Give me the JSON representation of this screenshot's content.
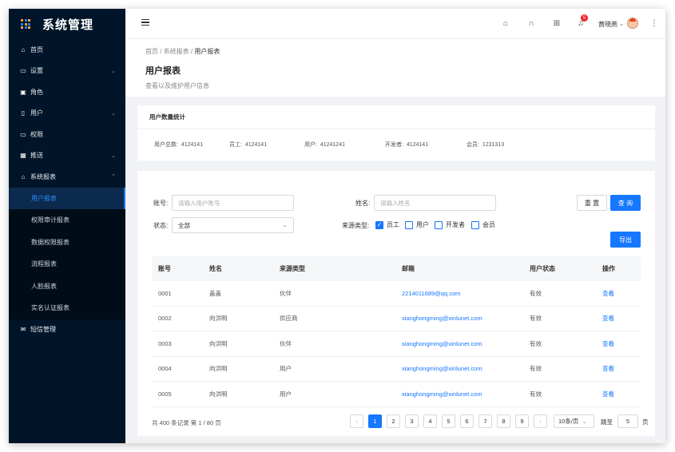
{
  "app": {
    "title": "系统管理"
  },
  "sidebar": {
    "items": [
      {
        "label": "首页",
        "icon": "home-icon"
      },
      {
        "label": "设置",
        "icon": "settings-icon"
      },
      {
        "label": "角色",
        "icon": "role-icon"
      },
      {
        "label": "用户",
        "icon": "user-icon"
      },
      {
        "label": "权限",
        "icon": "permission-icon"
      },
      {
        "label": "推送",
        "icon": "push-icon"
      },
      {
        "label": "系统报表",
        "icon": "home-icon"
      }
    ],
    "sub_items": [
      "用户报表",
      "权限审计报表",
      "数据权限报表",
      "流程报表",
      "人脸报表",
      "实名认证报表"
    ],
    "last_item": {
      "label": "短信管理",
      "icon": "mail-icon"
    }
  },
  "topbar": {
    "notification_count": "5",
    "username": "黄晓燕"
  },
  "header": {
    "breadcrumb": [
      "首页",
      "系统报表",
      "用户报表"
    ],
    "title": "用户报表",
    "description": "查看以及维护用户信息"
  },
  "stats": {
    "title": "用户数量统计",
    "items": [
      {
        "label": "用户总数:",
        "value": "4124141"
      },
      {
        "label": "员工:",
        "value": "4124141"
      },
      {
        "label": "用户:",
        "value": "41241241"
      },
      {
        "label": "开发者:",
        "value": "4124141"
      },
      {
        "label": "会员:",
        "value": "1231313"
      }
    ]
  },
  "filters": {
    "account_label": "账号:",
    "account_placeholder": "请输入用户账号",
    "name_label": "姓名:",
    "name_placeholder": "请输入姓名",
    "status_label": "状态:",
    "status_value": "全部",
    "source_label": "来源类型:",
    "sources": [
      {
        "label": "员工",
        "checked": true
      },
      {
        "label": "用户",
        "checked": false
      },
      {
        "label": "开发者",
        "checked": false
      },
      {
        "label": "会员",
        "checked": false
      }
    ],
    "reset_label": "重 置",
    "search_label": "查 询",
    "export_label": "导出"
  },
  "table": {
    "columns": [
      "账号",
      "姓名",
      "来源类型",
      "邮箱",
      "用户状态",
      "操作"
    ],
    "rows": [
      [
        "0001",
        "盖盖",
        "伙伴",
        "2214011689@qq.com",
        "有效",
        "查看"
      ],
      [
        "0002",
        "向洪明",
        "供应商",
        "xianghongming@xinlunet.com",
        "有效",
        "查看"
      ],
      [
        "0003",
        "向洪明",
        "伙伴",
        "xianghongming@xinlunet.com",
        "有效",
        "查看"
      ],
      [
        "0004",
        "向洪明",
        "用户",
        "xianghongming@xinlunet.com",
        "有效",
        "查看"
      ],
      [
        "0005",
        "向洪明",
        "用户",
        "xianghongming@xinlunet.com",
        "有效",
        "查看"
      ]
    ]
  },
  "pagination": {
    "total_text": "共 400 条记录 第 1 / 80 页",
    "pages": [
      "1",
      "2",
      "3",
      "4",
      "5",
      "6",
      "7",
      "8",
      "9"
    ],
    "current": "1",
    "page_size": "10条/页",
    "goto_label": "跳至",
    "goto_value": "5",
    "goto_suffix": "页"
  },
  "colors": {
    "sidebar_bg": "#001529",
    "accent": "#1677ff",
    "badge": "#f5222d"
  }
}
